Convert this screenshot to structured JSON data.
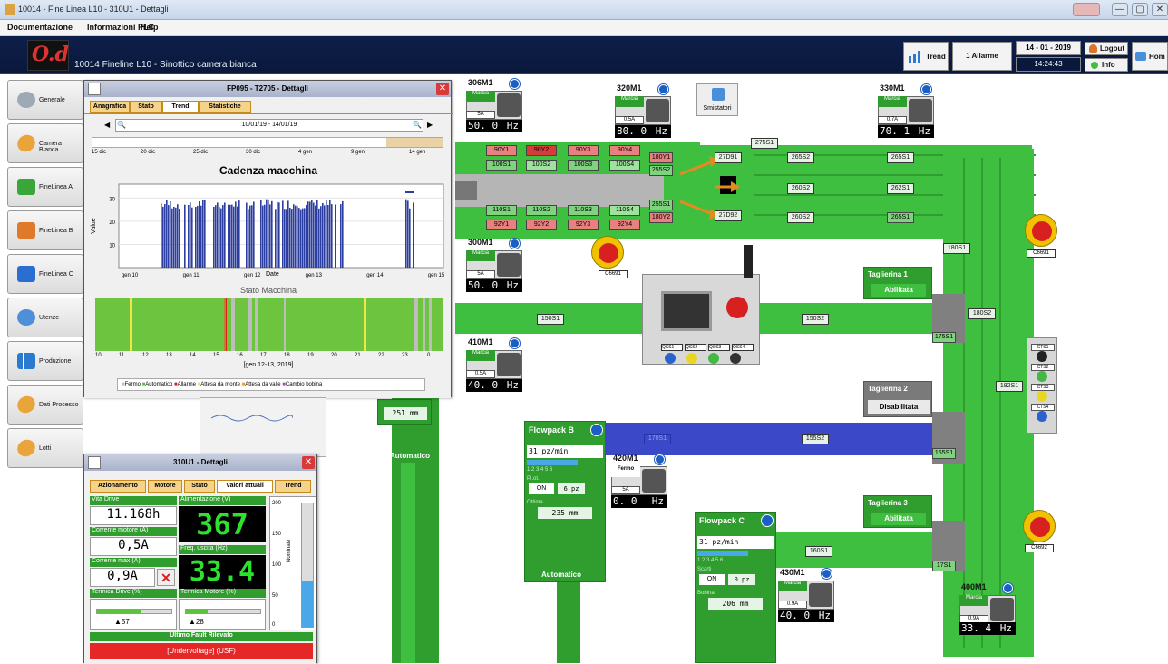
{
  "window": {
    "title": "10014 - Fine Linea L10 - 310U1 - Dettagli",
    "min": "—",
    "max": "▢",
    "close": "✕"
  },
  "menu": [
    "Documentazione",
    "Informazioni PLC",
    "Help"
  ],
  "header": {
    "logo_text": "O.d",
    "title": "10014 Fineline L10 - Sinottico camera bianca",
    "trend": "Trend",
    "alarms": "1 Allarme",
    "date": "14 - 01 - 2019",
    "time": "14:24:43",
    "logout": "Logout",
    "info": "Info",
    "home": "Hom"
  },
  "sidebar": [
    {
      "label": "Generale",
      "icon": "gears-icon"
    },
    {
      "label": "Camera Bianca",
      "icon": "bread-icon"
    },
    {
      "label": "FineLinea A",
      "icon": "cube-green-icon"
    },
    {
      "label": "FineLinea B",
      "icon": "cube-orange-icon"
    },
    {
      "label": "FineLinea C",
      "icon": "cube-blue-icon"
    },
    {
      "label": "Utenze",
      "icon": "users-gear-icon"
    },
    {
      "label": "Produzione",
      "icon": "chart-icon"
    },
    {
      "label": "Dati Processo",
      "icon": "bread-icon"
    },
    {
      "label": "Lotti",
      "icon": "bread-icon"
    }
  ],
  "trend_dialog": {
    "title": "FP095 - T2705 - Dettagli",
    "tabs": [
      "Anagrafica",
      "Stato",
      "Trend",
      "Statistiche"
    ],
    "active_tab": "Trend",
    "range": "10/01/19 - 14/01/19",
    "timeline_ticks": [
      "15 dic",
      "20 dic",
      "25 dic",
      "30 dic",
      "4 gen",
      "9 gen",
      "14 gen"
    ],
    "chart_title": "Cadenza macchina",
    "ylabel": "Value",
    "xlabel": "Date",
    "yticks": [
      "30",
      "20",
      "10"
    ],
    "xticks": [
      "gen 10",
      "gen 11",
      "gen 12",
      "gen 13",
      "gen 14",
      "gen 15"
    ],
    "state_title": "Stato Macchina",
    "state_ticks": [
      "10",
      "11",
      "12",
      "13",
      "14",
      "15",
      "16",
      "17",
      "18",
      "19",
      "20",
      "21",
      "22",
      "23",
      "0"
    ],
    "state_caption": "[gen 12-13, 2019]",
    "legend": [
      {
        "label": "Fermo",
        "color": "#bdbdbd"
      },
      {
        "label": "Automatico",
        "color": "#5cc23a"
      },
      {
        "label": "Allarme",
        "color": "#d82020"
      },
      {
        "label": "Attesa da monte",
        "color": "#f0e64a"
      },
      {
        "label": "Attesa da valle",
        "color": "#f39a2a"
      },
      {
        "label": "Cambio bobina",
        "color": "#9a4fc8"
      }
    ]
  },
  "drive_dialog": {
    "title": "310U1 - Dettagli",
    "tabs": [
      "Azionamento",
      "Motore",
      "Stato",
      "Valori attuali",
      "Trend"
    ],
    "active_tab": "Valori attuali",
    "vita_label": "Vita Drive",
    "vita_value": "11.168h",
    "corrente_label": "Corrente motore (A)",
    "corrente_value": "0,5A",
    "corrente_max_label": "Corrente max (A)",
    "corrente_max_value": "0,9A",
    "term_drive_label": "Termica Drive (%)",
    "term_drive_value": "57",
    "alim_label": "Alimentazione (V)",
    "alim_value": "367",
    "freq_label": "Freq. uscita (Hz)",
    "freq_value": "33.4",
    "term_motore_label": "Termica Motore (%)",
    "term_motore_value": "28",
    "gauge_ticks": [
      "200",
      "150",
      "100",
      "50",
      "0"
    ],
    "gauge_label": "Nominale",
    "fault_title": "Ultimo Fault Rilevato",
    "fault_value": "[Undervoltage] (USF)"
  },
  "motors": [
    {
      "name": "306M1",
      "state": "Marcia",
      "cur": "5A",
      "hz": "50. 0",
      "unit": "Hz"
    },
    {
      "name": "320M1",
      "state": "Marcia",
      "cur": "0.5A",
      "hz": "80. 0",
      "unit": "Hz"
    },
    {
      "name": "330M1",
      "state": "Marcia",
      "cur": "0.7A",
      "hz": "70. 1",
      "unit": "Hz"
    },
    {
      "name": "300M1",
      "state": "Marcia",
      "cur": "5A",
      "hz": "50. 0",
      "unit": "Hz"
    },
    {
      "name": "410M1",
      "state": "Marcia",
      "cur": "0.5A",
      "hz": "40. 0",
      "unit": "Hz"
    },
    {
      "name": "420M1",
      "state": "Fermo",
      "cur": "5A",
      "hz": "0. 0",
      "unit": "Hz"
    },
    {
      "name": "430M1",
      "state": "Marcia",
      "cur": "0.9A",
      "hz": "40. 0",
      "unit": "Hz"
    },
    {
      "name": "400M1",
      "state": "Marcia",
      "cur": "0.9A",
      "hz": "33. 4",
      "unit": "Hz"
    }
  ],
  "smistatori": "Smistatori",
  "labels": {
    "red_top": [
      "90Y1",
      "90Y2",
      "90Y3",
      "90Y4"
    ],
    "green_top": [
      "100S1",
      "100S2",
      "100S3",
      "100S4"
    ],
    "green_bot": [
      "110S1",
      "110S2",
      "110S3",
      "110S4"
    ],
    "red_bot": [
      "92Y1",
      "92Y2",
      "92Y3",
      "92Y4"
    ],
    "mid_right": [
      "180Y1",
      "255S2",
      "255S1",
      "180Y2"
    ],
    "sorter": [
      "27D91",
      "27D92",
      "275S1",
      "265S2",
      "265S1",
      "260S2",
      "262S1",
      "260S2",
      "265S1"
    ],
    "right_col": [
      "180S1",
      "180S2",
      "182S1",
      "175S1"
    ],
    "lines": [
      "150S1",
      "150S2",
      "170S1",
      "155S2",
      "155S1",
      "160S1",
      "17S1"
    ],
    "estops": [
      "C6691",
      "C6691",
      "C6692"
    ]
  },
  "taglierine": [
    {
      "name": "Taglierina 1",
      "state": "Abilitata"
    },
    {
      "name": "Taglierina 2",
      "state": "Disabilitata"
    },
    {
      "name": "Taglierina 3",
      "state": "Abilitata"
    }
  ],
  "flowpack_b": {
    "title": "Flowpack B",
    "speed": "31 pz/min",
    "scale": "1 2 3 4 5 6",
    "ploti_label": "Pl.ot.i",
    "on": "ON",
    "pz": "6 pz",
    "ottima_label": "Ottima",
    "ottima": "235 mm",
    "mode": "Automatico"
  },
  "flowpack_c": {
    "title": "Flowpack C",
    "speed": "31 pz/min",
    "scale": "1 2 3 4 5 6",
    "scarti_label": "Scarti",
    "on": "ON",
    "pz": "0 pz",
    "bobina_label": "Bobina",
    "bobina": "206 mm"
  },
  "flowpack_a": {
    "value": "251 mm",
    "mode": "Automatico"
  },
  "side_panel_tags": [
    "CTS1",
    "CTS2",
    "CTS3",
    "CTS4"
  ],
  "operator_panel_tags": [
    "QSS1",
    "QSS2",
    "QSS3",
    "QSS4"
  ]
}
